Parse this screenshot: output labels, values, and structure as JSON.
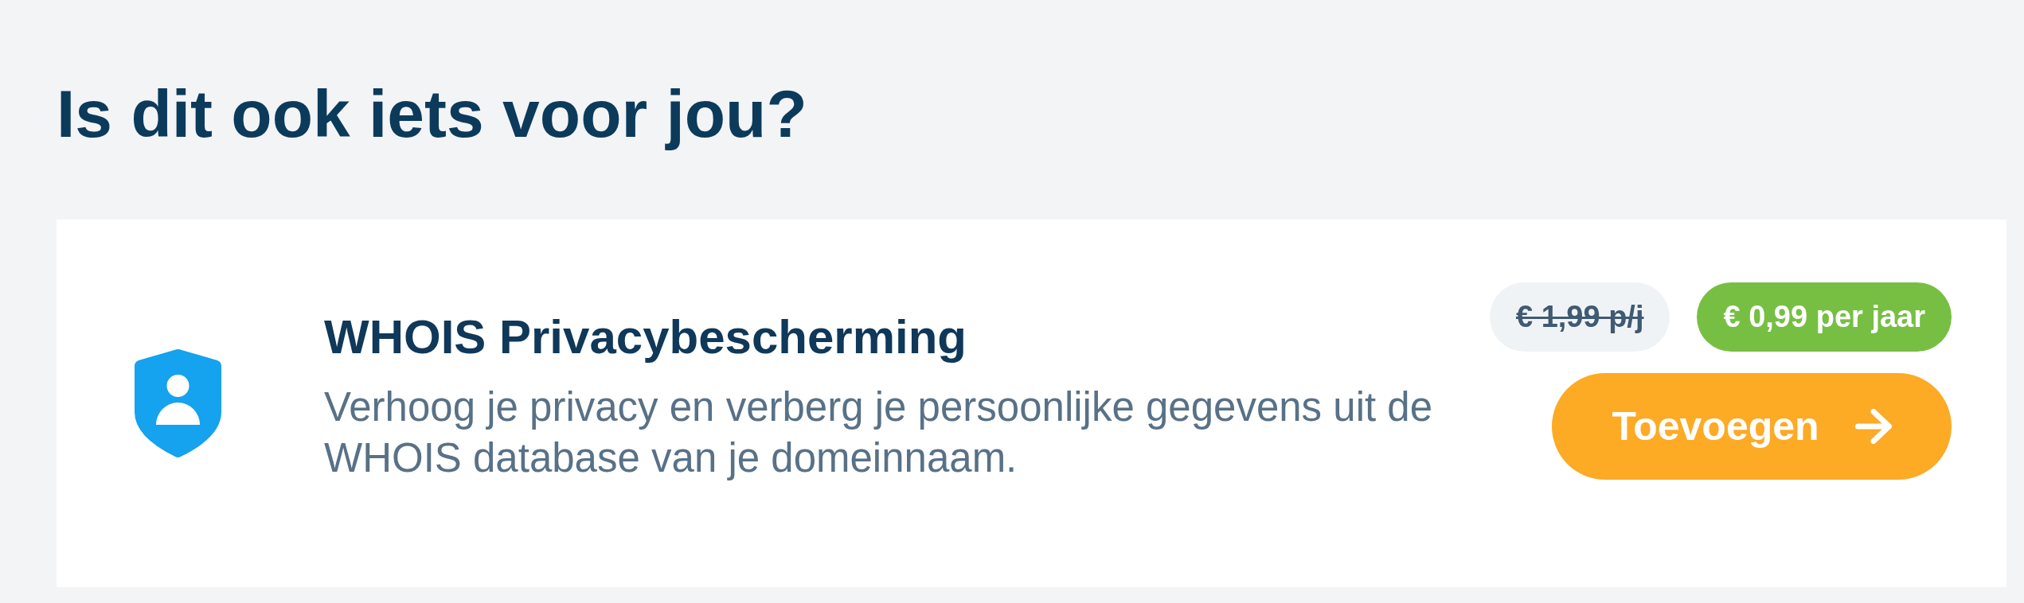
{
  "heading": "Is dit ook iets voor jou?",
  "offer": {
    "title": "WHOIS Privacybescherming",
    "description": "Verhoog je privacy en verberg je persoonlijke gegevens uit de WHOIS database van je domeinnaam.",
    "prices": [
      {
        "kind": "old",
        "text": "€ 1,99 p/j"
      },
      {
        "kind": "current",
        "text": "€ 0,99 per jaar"
      }
    ],
    "button": {
      "label": "Toevoegen"
    }
  }
}
